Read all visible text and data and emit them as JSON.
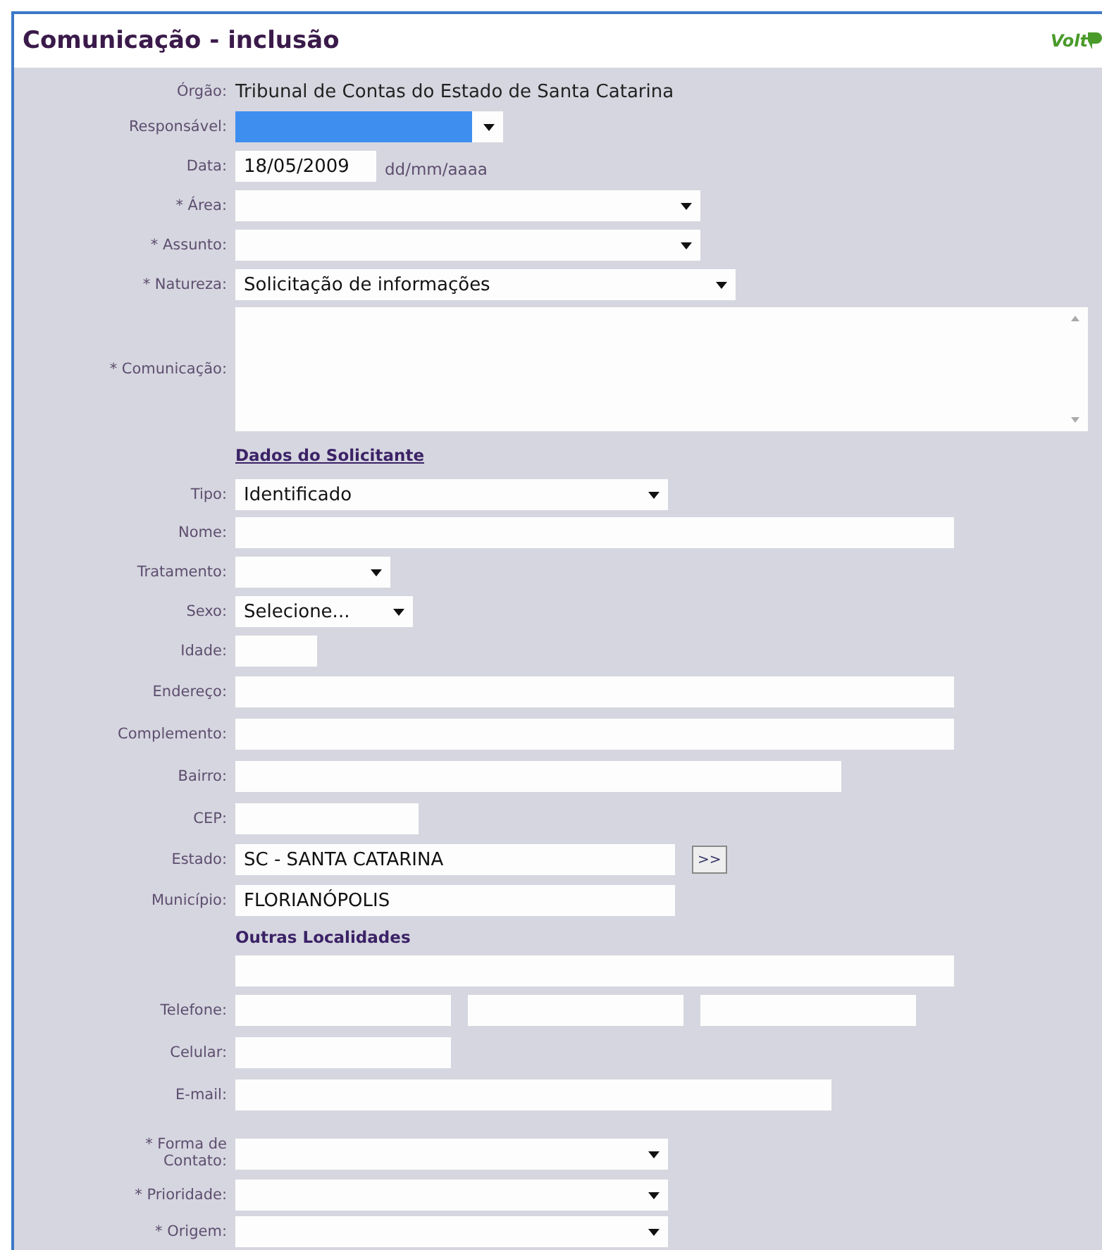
{
  "header": {
    "title": "Comunicação - inclusão",
    "back_link": "Volt"
  },
  "rows": [
    {
      "label": "Órgão:",
      "kind": "text",
      "value": "Tribunal de Contas do Estado de Santa Catarina"
    },
    {
      "label": "Responsável:",
      "kind": "select",
      "highlighted": true
    },
    {
      "label": "Data:",
      "kind": "input",
      "value": "18/05/2009",
      "hint": "dd/mm/aaaa"
    },
    {
      "label": "* Área:",
      "kind": "select"
    },
    {
      "label": "* Assunto:",
      "kind": "select"
    },
    {
      "label": "* Natureza:",
      "kind": "select",
      "value": "Solicitação de informações"
    },
    {
      "label": "* Comunicação:",
      "kind": "textarea"
    },
    {
      "kind": "link_heading",
      "value": "Dados do Solicitante"
    },
    {
      "label": "Tipo:",
      "kind": "select",
      "value": "Identificado"
    },
    {
      "label": "Nome:",
      "kind": "input"
    },
    {
      "label": "Tratamento:",
      "kind": "select"
    },
    {
      "label": "Sexo:",
      "kind": "select",
      "value": "Selecione..."
    },
    {
      "label": "Idade:",
      "kind": "input"
    },
    {
      "label": "Endereço:",
      "kind": "input"
    },
    {
      "label": "Complemento:",
      "kind": "input"
    },
    {
      "label": "Bairro:",
      "kind": "input"
    },
    {
      "label": "CEP:",
      "kind": "input"
    },
    {
      "label": "Estado:",
      "kind": "input",
      "value": "SC - SANTA CATARINA",
      "button": ">>"
    },
    {
      "label": "Município:",
      "kind": "input",
      "value": "FLORIANÓPOLIS"
    },
    {
      "kind": "heading",
      "value": "Outras Localidades"
    },
    {
      "kind": "input"
    },
    {
      "label": "Telefone:",
      "kind": "multi",
      "fields": [
        {
          "kind": "input"
        },
        {
          "kind": "input"
        },
        {
          "kind": "input"
        }
      ]
    },
    {
      "label": "Celular:",
      "kind": "input"
    },
    {
      "label": "E-mail:",
      "kind": "input"
    },
    {
      "label": "* Forma de Contato:",
      "kind": "select"
    },
    {
      "label": "* Prioridade:",
      "kind": "select"
    },
    {
      "label": "* Origem:",
      "kind": "select"
    }
  ]
}
